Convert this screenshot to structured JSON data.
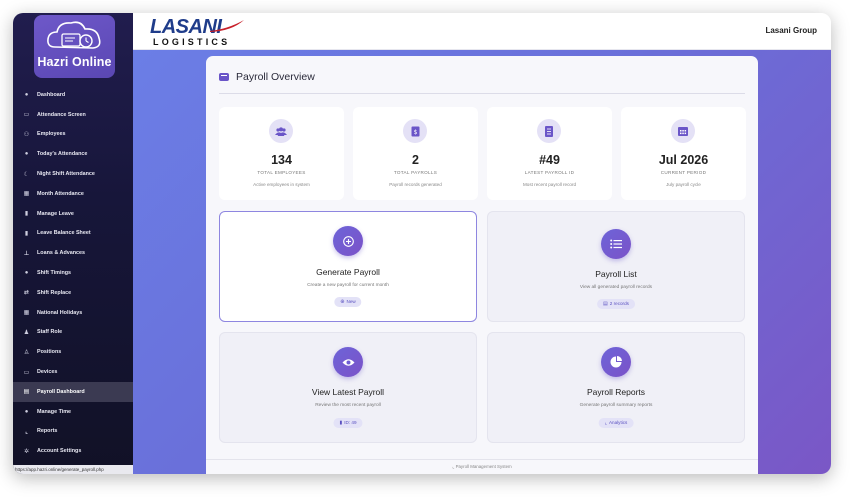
{
  "app": {
    "logo_text": "Hazri Online",
    "status_url": "https://app.hazri.online/generate_payroll.php"
  },
  "sidebar": {
    "items": [
      {
        "label": "Dashboard",
        "icon": "dashboard-icon"
      },
      {
        "label": "Attendance Screen",
        "icon": "monitor-icon"
      },
      {
        "label": "Employees",
        "icon": "users-icon"
      },
      {
        "label": "Today's Attendance",
        "icon": "clock-icon"
      },
      {
        "label": "Night Shift Attendance",
        "icon": "moon-icon"
      },
      {
        "label": "Month Attendance",
        "icon": "calendar-icon"
      },
      {
        "label": "Manage Leave",
        "icon": "document-icon"
      },
      {
        "label": "Leave Balance Sheet",
        "icon": "sheet-icon"
      },
      {
        "label": "Loans & Advances",
        "icon": "hand-money-icon"
      },
      {
        "label": "Shift Timings",
        "icon": "clock-icon"
      },
      {
        "label": "Shift Replace",
        "icon": "swap-icon"
      },
      {
        "label": "National Holidays",
        "icon": "calendar-icon"
      },
      {
        "label": "Staff Role",
        "icon": "user-tag-icon"
      },
      {
        "label": "Positions",
        "icon": "user-icon"
      },
      {
        "label": "Devices",
        "icon": "laptop-icon"
      },
      {
        "label": "Payroll Dashboard",
        "icon": "money-icon",
        "active": true
      },
      {
        "label": "Manage Time",
        "icon": "stopwatch-icon"
      },
      {
        "label": "Reports",
        "icon": "chart-icon"
      },
      {
        "label": "Account Settings",
        "icon": "gear-icon"
      }
    ]
  },
  "header": {
    "brand_main": "LASANI",
    "brand_sub": "LOGISTICS",
    "user": "Lasani Group"
  },
  "page": {
    "title": "Payroll Overview",
    "stats": [
      {
        "value": "134",
        "label": "TOTAL EMPLOYEES",
        "desc": "Active employees in system",
        "icon": "users-icon"
      },
      {
        "value": "2",
        "label": "TOTAL PAYROLLS",
        "desc": "Payroll records generated",
        "icon": "money-file-icon"
      },
      {
        "value": "#49",
        "label": "LATEST PAYROLL ID",
        "desc": "Most recent payroll record",
        "icon": "receipt-icon"
      },
      {
        "value": "Jul 2026",
        "label": "CURRENT PERIOD",
        "desc": "July payroll cycle",
        "icon": "calendar-icon"
      }
    ],
    "actions": [
      {
        "title": "Generate Payroll",
        "desc": "Create a new payroll for current month",
        "pill": "New",
        "icon": "plus-circle-icon"
      },
      {
        "title": "Payroll List",
        "desc": "View all generated payroll records",
        "pill": "2 records",
        "icon": "list-icon"
      },
      {
        "title": "View Latest Payroll",
        "desc": "Review the most recent payroll",
        "pill": "ID: 49",
        "icon": "eye-icon"
      },
      {
        "title": "Payroll Reports",
        "desc": "Generate payroll summary reports",
        "pill": "Analytics",
        "icon": "pie-chart-icon"
      }
    ],
    "footer": "Payroll Management System"
  },
  "colors": {
    "accent": "#6a55c8",
    "sidebar_bg": "#1a1a3a",
    "main_gradient_start": "#6b7ee6",
    "main_gradient_end": "#7a57c6"
  }
}
